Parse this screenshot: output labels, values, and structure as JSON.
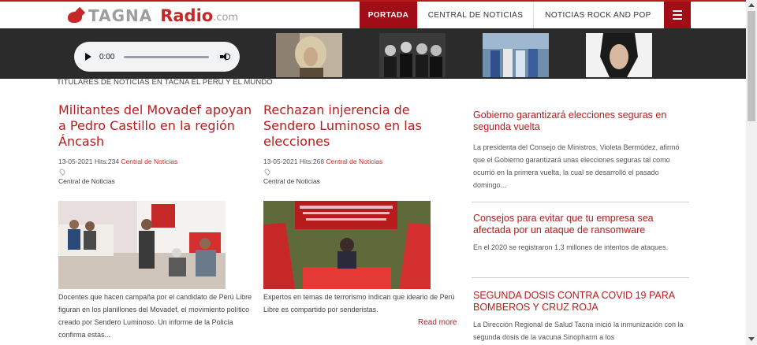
{
  "header": {
    "logo": {
      "part1": "TAGNA",
      "part2": "Radio",
      "part3": ".com"
    },
    "nav": [
      {
        "label": "PORTADA",
        "active": true
      },
      {
        "label": "CENTRAL DE NOTICIAS",
        "active": false
      },
      {
        "label": "NOTICIAS ROCK AND POP",
        "active": false
      }
    ],
    "accent": "#a00d16"
  },
  "player": {
    "time": "0:00"
  },
  "section_title": "TITULARES DE NOTICIAS EN TACNA EL PERÚ Y EL MUNDO",
  "articles": [
    {
      "title": "Militantes del Movadef apoyan a Pedro Castillo en la región Áncash",
      "date": "13-05-2021",
      "hits": "Hits:234",
      "category": "Central de Noticias",
      "author": "Central de Noticias",
      "caption": "Docentes que hacen campaña por el candidato de Perú Libre figuran en los planillones del Movadef, el movimiento político creado por Sendero Luminoso. Un informe de la Policía confirma estas..."
    },
    {
      "title": "Rechazan injerencia de Sendero Luminoso en las elecciones",
      "date": "13-05-2021",
      "hits": "Hits:268",
      "category": "Central de Noticias",
      "author": "Central de Noticias",
      "caption": "Expertos en temas de terrorismo indican que ideario de Perú Libre es compartido por senderistas.",
      "read_more": "Read more"
    }
  ],
  "sidebar": [
    {
      "title": "Gobierno garantizará elecciones seguras en segunda vuelta",
      "text": "La presidenta del Consejo de Ministros, Violeta Bermúdez, afirmó que el Gobierno garantizará unas elecciones seguras tal como ocurrió en la primera vuelta, la cual se desarrolló el pasado domingo..."
    },
    {
      "title": "Consejos para evitar que tu empresa sea afectada por un ataque de ransomware",
      "text": "En el 2020 se registraron 1.3 millones de intentos de ataques."
    },
    {
      "title": "SEGUNDA DOSIS CONTRA COVID 19 PARA BOMBEROS Y CRUZ ROJA",
      "text": "La Dirección Regional de Salud Tacna inició la inmunización con la segunda dosis de la vacuna Sinopharm a los"
    }
  ]
}
